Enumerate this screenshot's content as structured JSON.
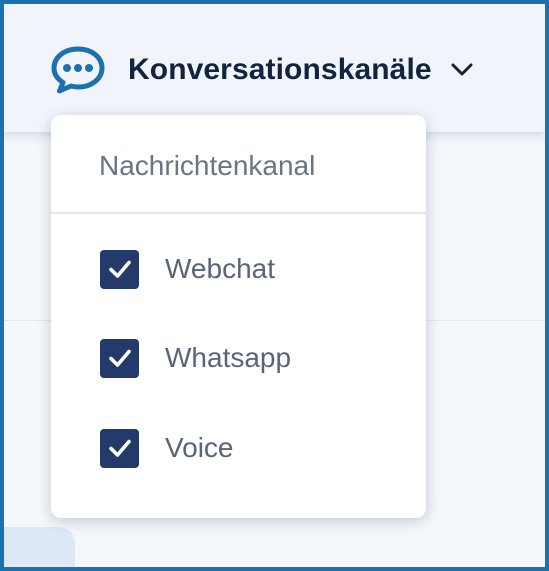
{
  "header": {
    "dropdown_label": "Konversationskanäle",
    "icon": "chat-bubble-ellipsis-icon",
    "chevron_icon": "chevron-down-icon"
  },
  "dropdown": {
    "title": "Nachrichtenkanal",
    "options": [
      {
        "label": "Webchat",
        "checked": true
      },
      {
        "label": "Whatsapp",
        "checked": true
      },
      {
        "label": "Voice",
        "checked": true
      }
    ]
  },
  "colors": {
    "frame_border": "#1a72b0",
    "icon_accent": "#1b72ae",
    "checkbox_fill": "#243a6b",
    "heading_text": "#12233f",
    "option_text": "#5a6479"
  }
}
